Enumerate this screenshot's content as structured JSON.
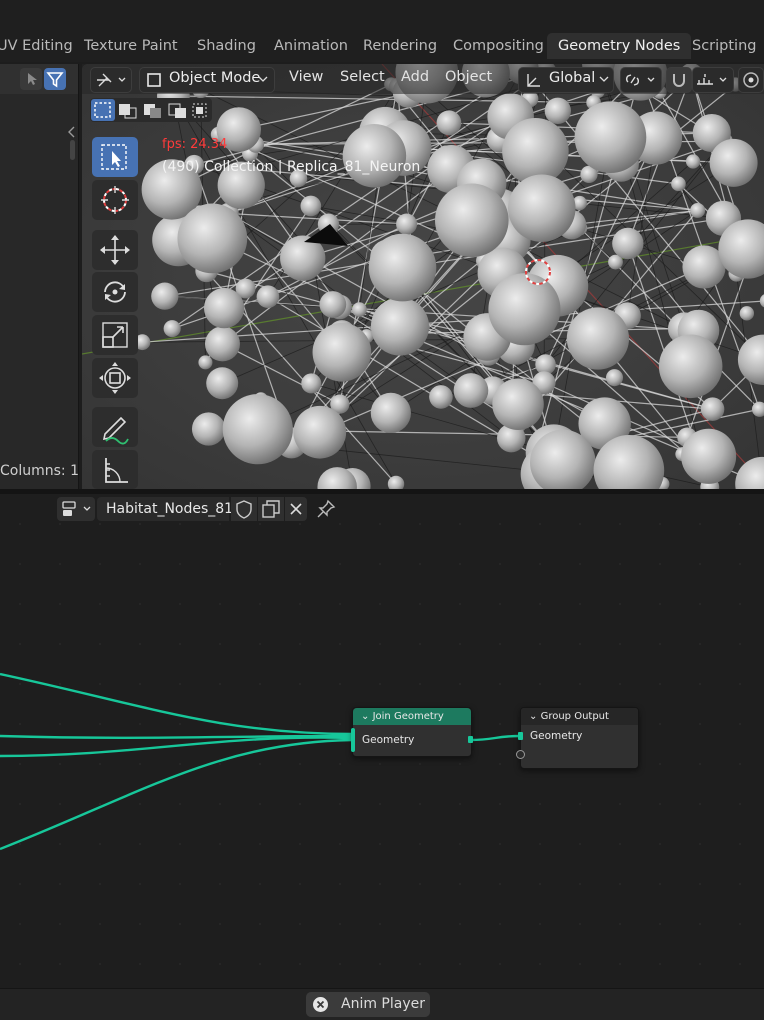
{
  "workspace_tabs": [
    {
      "label": "UV Editing",
      "active": false
    },
    {
      "label": "Texture Paint",
      "active": false
    },
    {
      "label": "Shading",
      "active": false
    },
    {
      "label": "Animation",
      "active": false
    },
    {
      "label": "Rendering",
      "active": false
    },
    {
      "label": "Compositing",
      "active": false
    },
    {
      "label": "Geometry Nodes",
      "active": true
    },
    {
      "label": "Scripting",
      "active": false
    }
  ],
  "outliner": {
    "columns_label": "Columns: 1"
  },
  "viewport": {
    "mode": "Object Mode",
    "menus": [
      "View",
      "Select",
      "Add",
      "Object"
    ],
    "transform_orientation": "Global",
    "fps": "fps: 24.34",
    "collection_info": "(490) Collection | Replica_81_Neuron",
    "tools": [
      "select-box-tool",
      "cursor-tool",
      "move-tool",
      "rotate-tool",
      "scale-tool",
      "transform-tool",
      "annotate-tool",
      "measure-tool"
    ]
  },
  "node_editor": {
    "node_group_name": "Habitat_Nodes_81",
    "nodes": {
      "join_geometry": {
        "title": "Join Geometry",
        "socket": "Geometry"
      },
      "group_output": {
        "title": "Group Output",
        "socket": "Geometry"
      }
    }
  },
  "status_bar": {
    "anim_player_label": "Anim Player"
  },
  "colors": {
    "geometry_link": "#17c79a",
    "active_tool": "#4772b3",
    "join_header": "#1d7a5f",
    "fps_red": "#ff3b3b"
  }
}
